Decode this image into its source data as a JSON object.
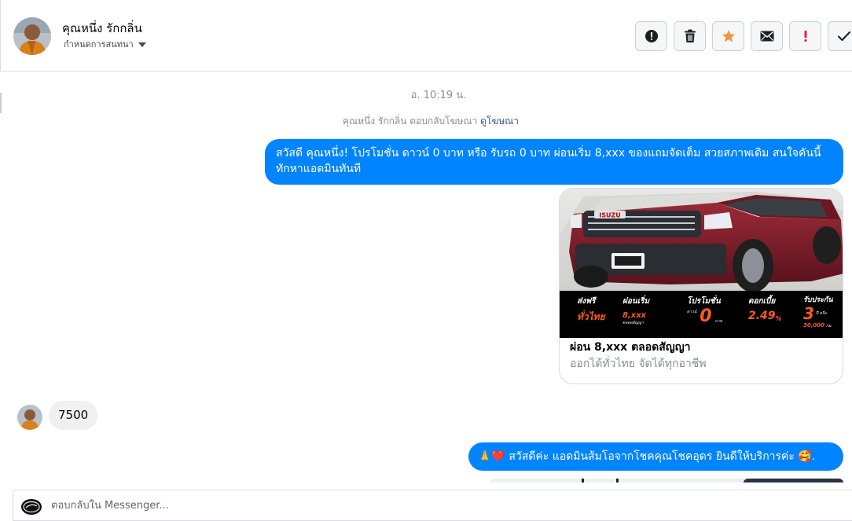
{
  "header": {
    "contact_name": "คุณหนึ่ง รักกลิ่น",
    "conversation_setting_label": "กำหนดการสนทนา",
    "toolbar": [
      {
        "icon": "alert-circle-icon"
      },
      {
        "icon": "trash-icon"
      },
      {
        "icon": "star-icon",
        "color": "#f7923b"
      },
      {
        "icon": "envelope-icon"
      },
      {
        "icon": "exclamation-icon",
        "color": "#e41e3f"
      },
      {
        "icon": "check-icon"
      }
    ]
  },
  "thread": {
    "timestamp": "อ. 10:19 น.",
    "ad_reply_note": "คุณหนึ่ง รักกลิ่น ตอบกลับโฆษณา",
    "ad_reply_link": "ดูโฆษณา",
    "message_1": "สวัสดี คุณหนึ่ง! โปรโมชั่น ดาวน์ 0 บาท หรือ รับรถ 0 บาท ผ่อนเริ่ม 8,xxx ของแถมจัดเต็ม สวยสภาพเดิม สนใจคันนี้ทักหาแอดมินทันที",
    "card": {
      "title": "ผ่อน 8,xxx ตลอดสัญญา",
      "subtitle": "ออกได้ทั่วไทย จัดได้ทุกอาชีพ",
      "image": {
        "brand": "ISUZU",
        "band": [
          {
            "top": "ส่งฟรี",
            "big": "ทั่วไทย"
          },
          {
            "top": "ผ่อนเริ่ม",
            "big": "8,xxx",
            "small": "ตลอดสัญญา"
          },
          {
            "top": "โปรโมชั่น",
            "pre": "ดาวน์",
            "big": "0",
            "small": "บาท"
          },
          {
            "top": "ดอกเบี้ย",
            "big": "2.49",
            "unit": "%"
          },
          {
            "top": "รับประกัน",
            "big": "3",
            "unit": "ปี หรือ",
            "small": "30,000",
            "small2": "กม."
          }
        ]
      }
    },
    "incoming_message": "7500",
    "message_2_emojis": "🙏❤️",
    "message_2": "สวัสดีค่ะ แอดมินส้มโอจากโชคคุณโชคอุดร ยินดีให้บริการค่ะ",
    "message_2_trailing_emoji": "🥰."
  },
  "composer": {
    "placeholder": "ตอบกลับใน Messenger..."
  },
  "colors": {
    "bubble_out": "#0084ff",
    "bubble_in": "#f0f0f0",
    "link": "#385898",
    "car_red": "#7a1f2b",
    "promo_orange": "#ff5a1f"
  }
}
